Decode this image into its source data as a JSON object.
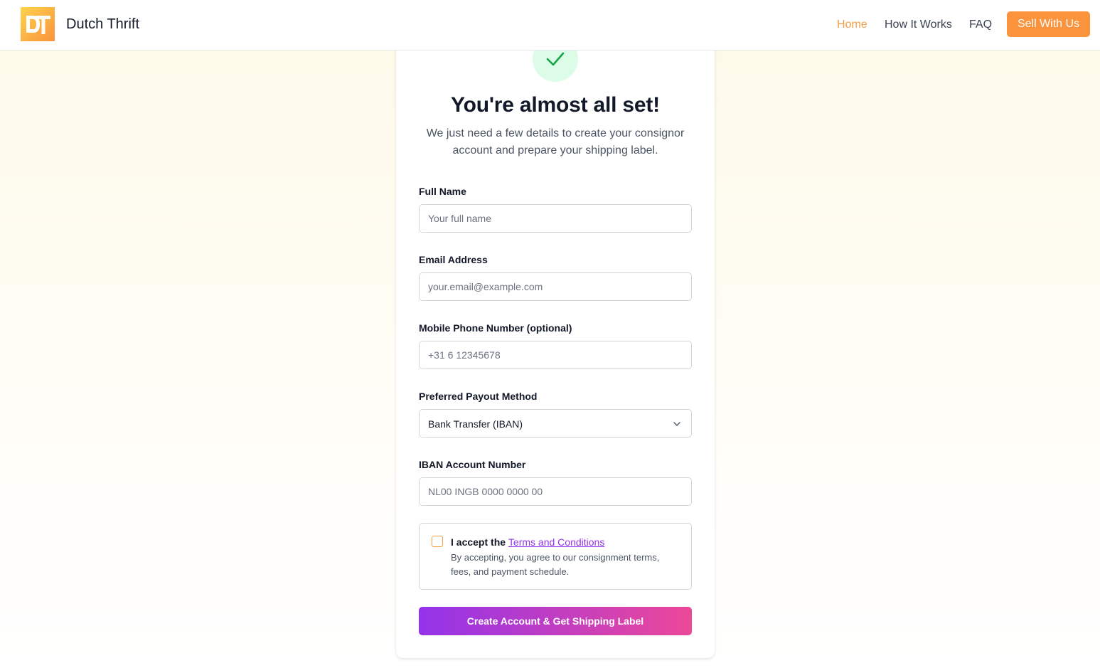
{
  "header": {
    "logo_text": "DT",
    "brand": "Dutch Thrift",
    "nav": {
      "home": "Home",
      "how": "How It Works",
      "faq": "FAQ"
    },
    "cta": "Sell With Us"
  },
  "form": {
    "title": "You're almost all set!",
    "subtitle": "We just need a few details to create your consignor account and prepare your shipping label.",
    "full_name": {
      "label": "Full Name",
      "placeholder": "Your full name",
      "value": ""
    },
    "email": {
      "label": "Email Address",
      "placeholder": "your.email@example.com",
      "value": ""
    },
    "phone": {
      "label": "Mobile Phone Number (optional)",
      "placeholder": "+31 6 12345678",
      "value": ""
    },
    "payout": {
      "label": "Preferred Payout Method",
      "selected": "Bank Transfer (IBAN)"
    },
    "iban": {
      "label": "IBAN Account Number",
      "placeholder": "NL00 INGB 0000 0000 00",
      "value": ""
    },
    "terms": {
      "prefix": "I accept the",
      "link": "Terms and Conditions",
      "description": "By accepting, you agree to our consignment terms, fees, and payment schedule.",
      "checked": false
    },
    "submit": "Create Account & Get Shipping Label"
  },
  "colors": {
    "accent_orange": "#fb923c",
    "success_green": "#16a34a",
    "gradient_start": "#9333ea",
    "gradient_end": "#ec4899"
  }
}
